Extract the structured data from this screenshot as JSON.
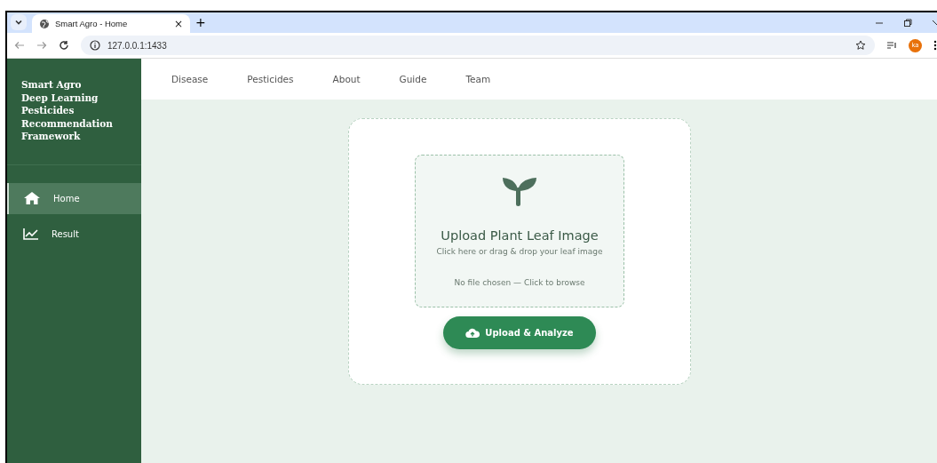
{
  "browser": {
    "tab": {
      "title": "Smart Agro - Home",
      "close": "×"
    },
    "new_tab": "+",
    "url": "127.0.0.1:1433",
    "profile": "ka"
  },
  "sidebar": {
    "title_lines": [
      "Smart Agro",
      "Deep Learning",
      "Pesticides",
      "Recommendation",
      "Framework"
    ],
    "items": [
      {
        "label": "Home",
        "kind": "home",
        "selected": true
      },
      {
        "label": "Result",
        "kind": "chart",
        "selected": false
      }
    ]
  },
  "nav": [
    "Disease",
    "Pesticides",
    "About",
    "Guide",
    "Team"
  ],
  "upload": {
    "title": "Upload Plant Leaf Image",
    "hint": "Click here or drag & drop your leaf image",
    "file_status": "No file chosen — Click to browse",
    "button": "Upload & Analyze"
  }
}
